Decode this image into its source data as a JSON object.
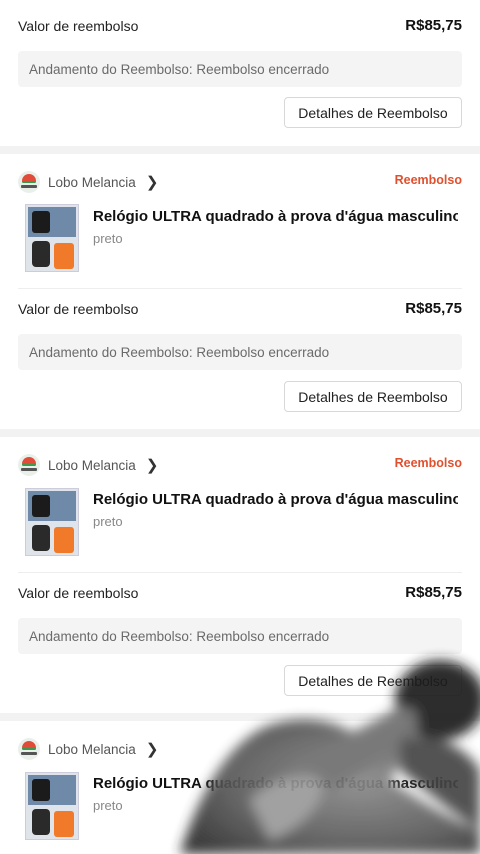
{
  "orders": [
    {
      "refund_label": "Valor de reembolso",
      "refund_amount": "R$85,75",
      "progress": "Andamento do Reembolso: Reembolso encerrado",
      "details_button": "Detalhes de Reembolso"
    },
    {
      "shop_name": "Lobo Melancia",
      "status": "Reembolso",
      "product_title": "Relógio ULTRA quadrado à prova d'água masculino...",
      "variant": "preto",
      "refund_label": "Valor de reembolso",
      "refund_amount": "R$85,75",
      "progress": "Andamento do Reembolso: Reembolso encerrado",
      "details_button": "Detalhes de Reembolso"
    },
    {
      "shop_name": "Lobo Melancia",
      "status": "Reembolso",
      "product_title": "Relógio ULTRA quadrado à prova d'água masculino...",
      "variant": "preto",
      "refund_label": "Valor de reembolso",
      "refund_amount": "R$85,75",
      "progress": "Andamento do Reembolso: Reembolso encerrado",
      "details_button": "Detalhes de Reembolso"
    },
    {
      "shop_name": "Lobo Melancia",
      "product_title": "Relógio ULTRA quadrado à prova d'água masculino...",
      "variant": "preto"
    }
  ],
  "colors": {
    "status": "#e0502e",
    "progress_bg": "#f4f4f4",
    "page_bg": "#f2f2f2"
  },
  "icons": {
    "chevron": "chevron-right-icon"
  }
}
